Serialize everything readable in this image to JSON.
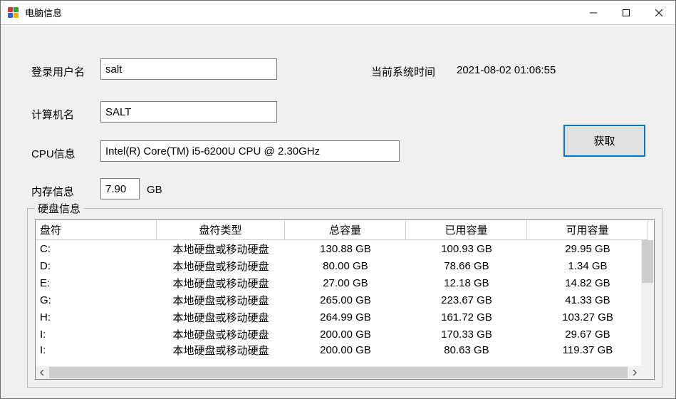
{
  "window": {
    "title": "电脑信息"
  },
  "labels": {
    "username": "登录用户名",
    "computer": "计算机名",
    "cpu": "CPU信息",
    "memory": "内存信息",
    "memory_unit": "GB",
    "systime": "当前系统时间",
    "disk_group": "硬盘信息",
    "fetch": "获取"
  },
  "values": {
    "username": "salt",
    "computer": "SALT",
    "cpu": "Intel(R) Core(TM) i5-6200U CPU @ 2.30GHz",
    "memory": "7.90",
    "systime": "2021-08-02  01:06:55"
  },
  "disk": {
    "columns": [
      "盘符",
      "盘符类型",
      "总容量",
      "已用容量",
      "可用容量"
    ],
    "rows": [
      {
        "drive": "C:",
        "type": "本地硬盘或移动硬盘",
        "total": "130.88 GB",
        "used": "100.93 GB",
        "free": "29.95 GB"
      },
      {
        "drive": "D:",
        "type": "本地硬盘或移动硬盘",
        "total": "80.00 GB",
        "used": "78.66 GB",
        "free": "1.34 GB"
      },
      {
        "drive": "E:",
        "type": "本地硬盘或移动硬盘",
        "total": "27.00 GB",
        "used": "12.18 GB",
        "free": "14.82 GB"
      },
      {
        "drive": "G:",
        "type": "本地硬盘或移动硬盘",
        "total": "265.00 GB",
        "used": "223.67 GB",
        "free": "41.33 GB"
      },
      {
        "drive": "H:",
        "type": "本地硬盘或移动硬盘",
        "total": "264.99 GB",
        "used": "161.72 GB",
        "free": "103.27 GB"
      },
      {
        "drive": "I:",
        "type": "本地硬盘或移动硬盘",
        "total": "200.00 GB",
        "used": "170.33 GB",
        "free": "29.67 GB"
      },
      {
        "drive": "I:",
        "type": "本地硬盘或移动硬盘",
        "total": "200.00 GB",
        "used": "80.63 GB",
        "free": "119.37 GB"
      }
    ]
  }
}
